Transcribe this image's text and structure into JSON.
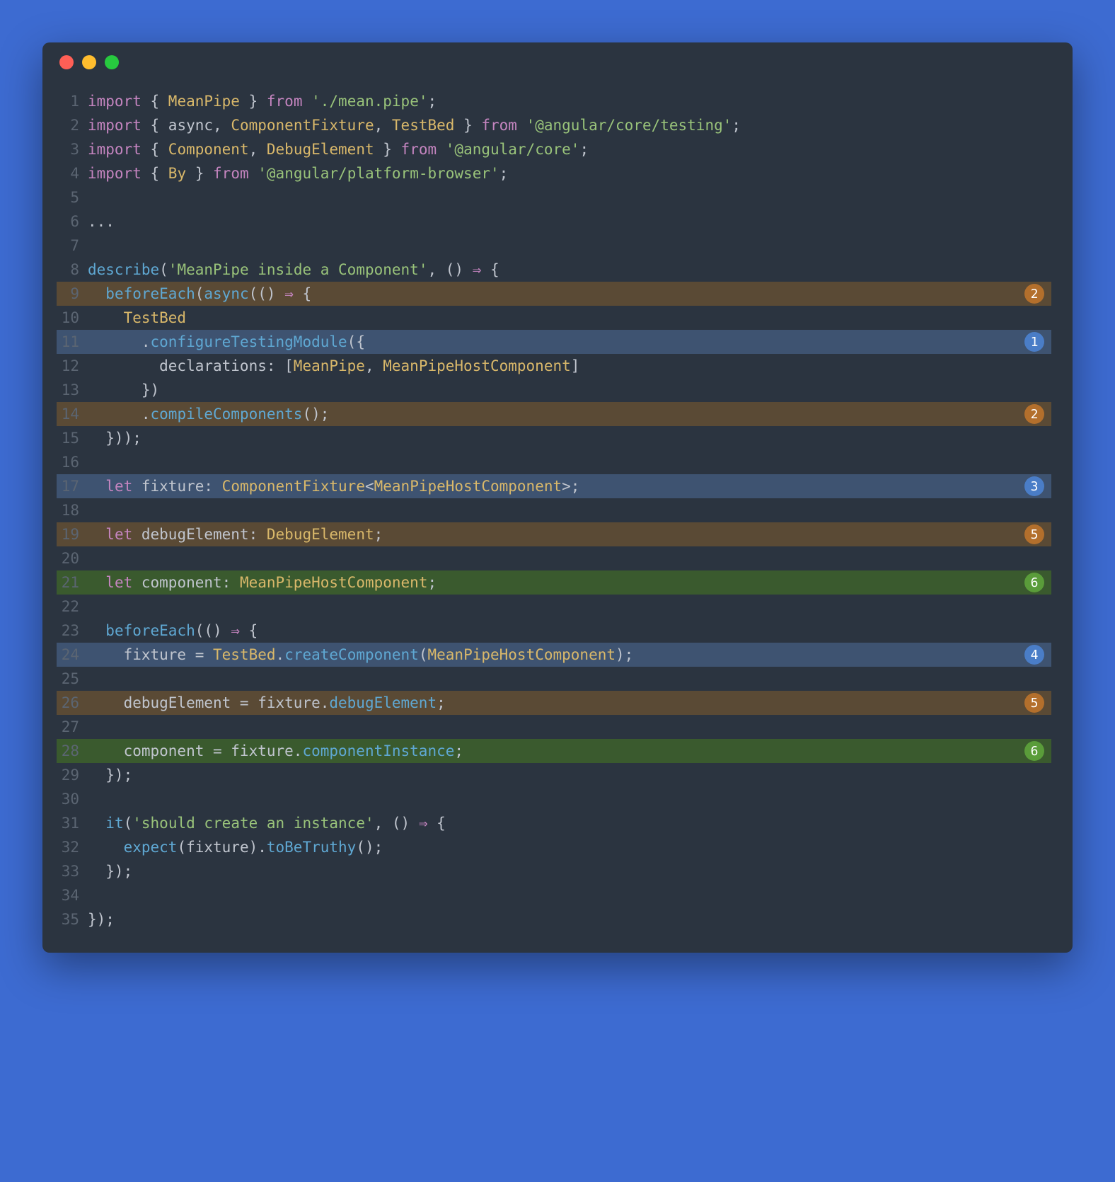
{
  "window": {
    "dots": [
      "red",
      "yellow",
      "green"
    ]
  },
  "annotations": {
    "9": {
      "num": "2",
      "color": "brown",
      "hl": "brown"
    },
    "11": {
      "num": "1",
      "color": "blue",
      "hl": "blue"
    },
    "14": {
      "num": "2",
      "color": "brown",
      "hl": "brown"
    },
    "17": {
      "num": "3",
      "color": "blue",
      "hl": "blue"
    },
    "19": {
      "num": "5",
      "color": "brown",
      "hl": "brown"
    },
    "21": {
      "num": "6",
      "color": "green",
      "hl": "green"
    },
    "24": {
      "num": "4",
      "color": "blue",
      "hl": "blue"
    },
    "26": {
      "num": "5",
      "color": "brown",
      "hl": "brown"
    },
    "28": {
      "num": "6",
      "color": "green",
      "hl": "green"
    }
  },
  "lines": [
    {
      "n": 1,
      "t": [
        [
          "kw",
          "import"
        ],
        [
          "default",
          " { "
        ],
        [
          "type",
          "MeanPipe"
        ],
        [
          "default",
          " } "
        ],
        [
          "kw",
          "from"
        ],
        [
          "default",
          " "
        ],
        [
          "str",
          "'./mean.pipe'"
        ],
        [
          "default",
          ";"
        ]
      ]
    },
    {
      "n": 2,
      "t": [
        [
          "kw",
          "import"
        ],
        [
          "default",
          " { "
        ],
        [
          "default",
          "async, "
        ],
        [
          "type",
          "ComponentFixture"
        ],
        [
          "default",
          ", "
        ],
        [
          "type",
          "TestBed"
        ],
        [
          "default",
          " } "
        ],
        [
          "kw",
          "from"
        ],
        [
          "default",
          " "
        ],
        [
          "str",
          "'@angular/core/testing'"
        ],
        [
          "default",
          ";"
        ]
      ]
    },
    {
      "n": 3,
      "t": [
        [
          "kw",
          "import"
        ],
        [
          "default",
          " { "
        ],
        [
          "type",
          "Component"
        ],
        [
          "default",
          ", "
        ],
        [
          "type",
          "DebugElement"
        ],
        [
          "default",
          " } "
        ],
        [
          "kw",
          "from"
        ],
        [
          "default",
          " "
        ],
        [
          "str",
          "'@angular/core'"
        ],
        [
          "default",
          ";"
        ]
      ]
    },
    {
      "n": 4,
      "t": [
        [
          "kw",
          "import"
        ],
        [
          "default",
          " { "
        ],
        [
          "type",
          "By"
        ],
        [
          "default",
          " } "
        ],
        [
          "kw",
          "from"
        ],
        [
          "default",
          " "
        ],
        [
          "str",
          "'@angular/platform-browser'"
        ],
        [
          "default",
          ";"
        ]
      ]
    },
    {
      "n": 5,
      "t": []
    },
    {
      "n": 6,
      "t": [
        [
          "default",
          "..."
        ]
      ]
    },
    {
      "n": 7,
      "t": []
    },
    {
      "n": 8,
      "t": [
        [
          "fn",
          "describe"
        ],
        [
          "default",
          "("
        ],
        [
          "str",
          "'MeanPipe inside a Component'"
        ],
        [
          "default",
          ", () "
        ],
        [
          "kw",
          "⇒"
        ],
        [
          "default",
          " {"
        ]
      ]
    },
    {
      "n": 9,
      "t": [
        [
          "default",
          "  "
        ],
        [
          "fn",
          "beforeEach"
        ],
        [
          "default",
          "("
        ],
        [
          "fn",
          "async"
        ],
        [
          "default",
          "(() "
        ],
        [
          "kw",
          "⇒"
        ],
        [
          "default",
          " {"
        ]
      ]
    },
    {
      "n": 10,
      "t": [
        [
          "default",
          "    "
        ],
        [
          "type",
          "TestBed"
        ]
      ]
    },
    {
      "n": 11,
      "t": [
        [
          "default",
          "      ."
        ],
        [
          "prop",
          "configureTestingModule"
        ],
        [
          "default",
          "({"
        ]
      ]
    },
    {
      "n": 12,
      "t": [
        [
          "default",
          "        declarations: ["
        ],
        [
          "type",
          "MeanPipe"
        ],
        [
          "default",
          ", "
        ],
        [
          "type",
          "MeanPipeHostComponent"
        ],
        [
          "default",
          "]"
        ]
      ]
    },
    {
      "n": 13,
      "t": [
        [
          "default",
          "      })"
        ]
      ]
    },
    {
      "n": 14,
      "t": [
        [
          "default",
          "      ."
        ],
        [
          "prop",
          "compileComponents"
        ],
        [
          "default",
          "();"
        ]
      ]
    },
    {
      "n": 15,
      "t": [
        [
          "default",
          "  }));"
        ]
      ]
    },
    {
      "n": 16,
      "t": []
    },
    {
      "n": 17,
      "t": [
        [
          "default",
          "  "
        ],
        [
          "let",
          "let"
        ],
        [
          "default",
          " fixture: "
        ],
        [
          "type",
          "ComponentFixture"
        ],
        [
          "default",
          "<"
        ],
        [
          "type",
          "MeanPipeHostComponent"
        ],
        [
          "default",
          ">;"
        ]
      ]
    },
    {
      "n": 18,
      "t": []
    },
    {
      "n": 19,
      "t": [
        [
          "default",
          "  "
        ],
        [
          "let",
          "let"
        ],
        [
          "default",
          " debugElement: "
        ],
        [
          "type",
          "DebugElement"
        ],
        [
          "default",
          ";"
        ]
      ]
    },
    {
      "n": 20,
      "t": []
    },
    {
      "n": 21,
      "t": [
        [
          "default",
          "  "
        ],
        [
          "let",
          "let"
        ],
        [
          "default",
          " component: "
        ],
        [
          "type",
          "MeanPipeHostComponent"
        ],
        [
          "default",
          ";"
        ]
      ]
    },
    {
      "n": 22,
      "t": []
    },
    {
      "n": 23,
      "t": [
        [
          "default",
          "  "
        ],
        [
          "fn",
          "beforeEach"
        ],
        [
          "default",
          "(() "
        ],
        [
          "kw",
          "⇒"
        ],
        [
          "default",
          " {"
        ]
      ]
    },
    {
      "n": 24,
      "t": [
        [
          "default",
          "    fixture = "
        ],
        [
          "type",
          "TestBed"
        ],
        [
          "default",
          "."
        ],
        [
          "prop",
          "createComponent"
        ],
        [
          "default",
          "("
        ],
        [
          "type",
          "MeanPipeHostComponent"
        ],
        [
          "default",
          ");"
        ]
      ]
    },
    {
      "n": 25,
      "t": []
    },
    {
      "n": 26,
      "t": [
        [
          "default",
          "    debugElement = fixture."
        ],
        [
          "prop",
          "debugElement"
        ],
        [
          "default",
          ";"
        ]
      ]
    },
    {
      "n": 27,
      "t": []
    },
    {
      "n": 28,
      "t": [
        [
          "default",
          "    component = fixture."
        ],
        [
          "prop",
          "componentInstance"
        ],
        [
          "default",
          ";"
        ]
      ]
    },
    {
      "n": 29,
      "t": [
        [
          "default",
          "  });"
        ]
      ]
    },
    {
      "n": 30,
      "t": []
    },
    {
      "n": 31,
      "t": [
        [
          "default",
          "  "
        ],
        [
          "fn",
          "it"
        ],
        [
          "default",
          "("
        ],
        [
          "str",
          "'should create an instance'"
        ],
        [
          "default",
          ", () "
        ],
        [
          "kw",
          "⇒"
        ],
        [
          "default",
          " {"
        ]
      ]
    },
    {
      "n": 32,
      "t": [
        [
          "default",
          "    "
        ],
        [
          "fn",
          "expect"
        ],
        [
          "default",
          "(fixture)."
        ],
        [
          "prop",
          "toBeTruthy"
        ],
        [
          "default",
          "();"
        ]
      ]
    },
    {
      "n": 33,
      "t": [
        [
          "default",
          "  });"
        ]
      ]
    },
    {
      "n": 34,
      "t": []
    },
    {
      "n": 35,
      "t": [
        [
          "default",
          "});"
        ]
      ]
    }
  ]
}
